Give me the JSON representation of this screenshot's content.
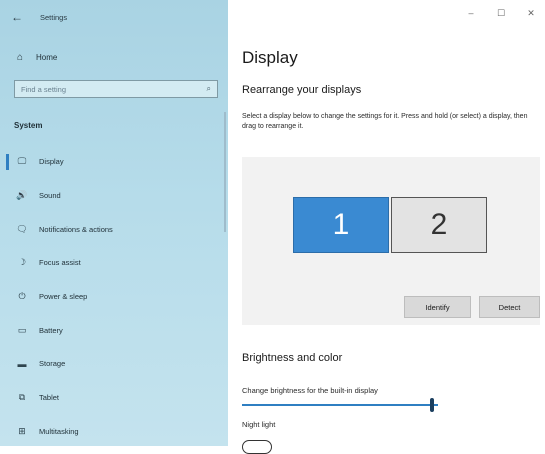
{
  "app": {
    "title": "Settings"
  },
  "window_controls": {
    "minimize": "–",
    "maximize": "☐",
    "close": "✕"
  },
  "sidebar": {
    "home_label": "Home",
    "search_placeholder": "Find a setting",
    "section": "System",
    "items": [
      {
        "label": "Display",
        "icon": "monitor-icon",
        "glyph": "🖵",
        "active": true
      },
      {
        "label": "Sound",
        "icon": "speaker-icon",
        "glyph": "🔊"
      },
      {
        "label": "Notifications & actions",
        "icon": "notification-icon",
        "glyph": "🗨"
      },
      {
        "label": "Focus assist",
        "icon": "moon-icon",
        "glyph": "☽"
      },
      {
        "label": "Power & sleep",
        "icon": "power-icon",
        "glyph": "⏻"
      },
      {
        "label": "Battery",
        "icon": "battery-icon",
        "glyph": "▭"
      },
      {
        "label": "Storage",
        "icon": "storage-icon",
        "glyph": "▬"
      },
      {
        "label": "Tablet",
        "icon": "tablet-icon",
        "glyph": "⧉"
      },
      {
        "label": "Multitasking",
        "icon": "multitasking-icon",
        "glyph": "⊞"
      }
    ]
  },
  "main": {
    "title": "Display",
    "rearrange": {
      "heading": "Rearrange your displays",
      "description": "Select a display below to change the settings for it. Press and hold (or select) a display, then drag to rearrange it.",
      "monitors": [
        "1",
        "2"
      ],
      "identify_label": "Identify",
      "detect_label": "Detect"
    },
    "brightness": {
      "heading": "Brightness and color",
      "slider_label": "Change brightness for the built-in display",
      "value_fraction": 0.98,
      "night_light_label": "Night light"
    }
  },
  "colors": {
    "accent": "#2f7fc2",
    "sidebar_bg": "#b6dcea",
    "monitor_selected": "#3a8ad2"
  }
}
